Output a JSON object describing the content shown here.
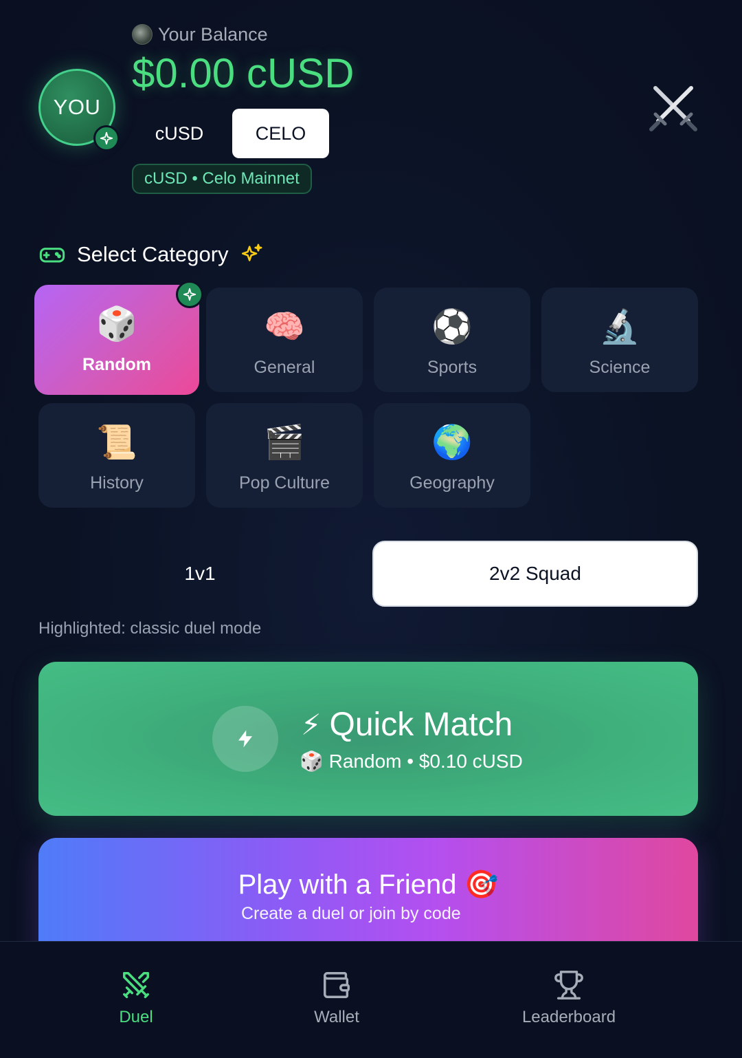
{
  "header": {
    "avatar_text": "YOU",
    "balance_label": "Your Balance",
    "balance_value": "$0.00 cUSD",
    "tokens": [
      {
        "label": "cUSD",
        "active": false
      },
      {
        "label": "CELO",
        "active": true
      }
    ],
    "network": "cUSD • Celo Mainnet",
    "icons": {
      "coin": "coin-icon",
      "swords": "crossed-swords-icon",
      "avatar_badge": "sparkle-icon"
    }
  },
  "categories": {
    "title": "Select Category",
    "items": [
      {
        "label": "Random",
        "emoji": "🎲",
        "selected": true
      },
      {
        "label": "General",
        "emoji": "🧠",
        "selected": false
      },
      {
        "label": "Sports",
        "emoji": "⚽",
        "selected": false
      },
      {
        "label": "Science",
        "emoji": "🔬",
        "selected": false
      },
      {
        "label": "History",
        "emoji": "📜",
        "selected": false
      },
      {
        "label": "Pop Culture",
        "emoji": "🎬",
        "selected": false
      },
      {
        "label": "Geography",
        "emoji": "🌍",
        "selected": false
      }
    ]
  },
  "modes": {
    "options": [
      {
        "label": "1v1",
        "active": false
      },
      {
        "label": "2v2 Squad",
        "active": true
      }
    ],
    "hint": "Highlighted: classic duel mode"
  },
  "quick_match": {
    "title": "Quick Match",
    "title_emoji": "⚡",
    "subtitle": "🎲 Random • $0.10 cUSD"
  },
  "friend": {
    "title": "Play with a Friend 🎯",
    "subtitle": "Create a duel or join by code"
  },
  "nav": {
    "items": [
      {
        "label": "Duel",
        "active": true
      },
      {
        "label": "Wallet",
        "active": false
      },
      {
        "label": "Leaderboard",
        "active": false
      }
    ]
  },
  "colors": {
    "background": "#0b1224",
    "accent_green": "#4ade80",
    "quick_match": "#45bd85",
    "selected_category_start": "#b565f5",
    "selected_category_end": "#ec4899",
    "friend_start": "#4f7cf8",
    "friend_end": "#e0489f"
  }
}
